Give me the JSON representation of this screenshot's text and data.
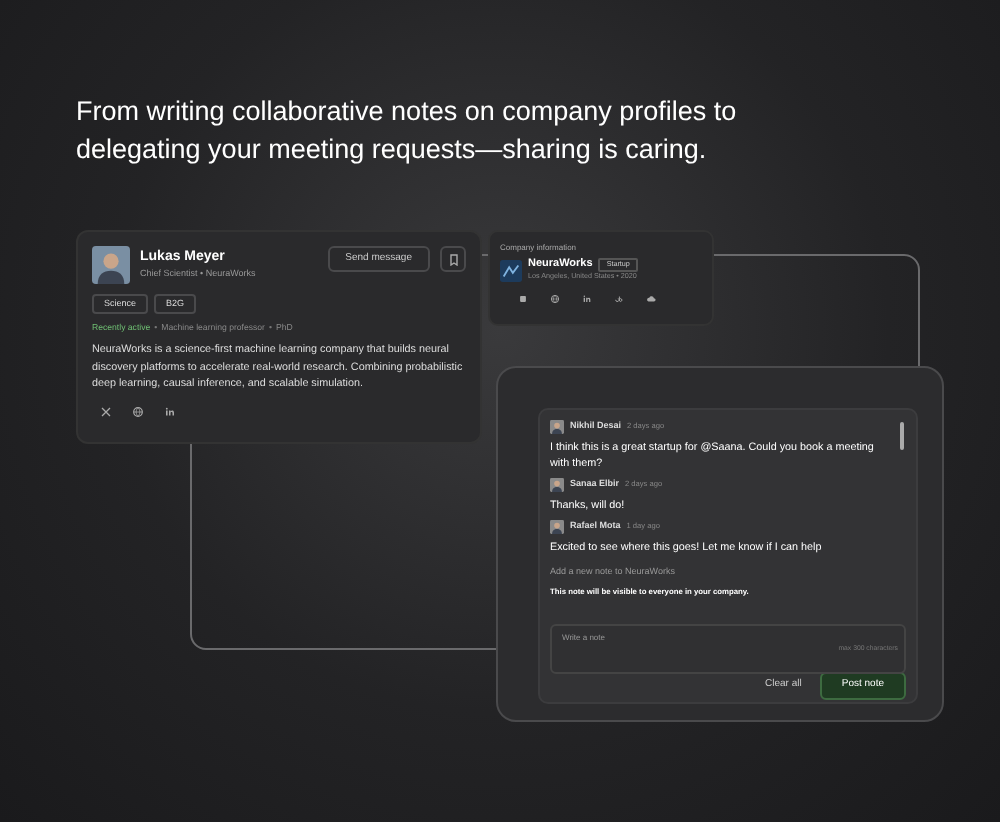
{
  "headline": "From writing collaborative notes on company profiles to delegating your meeting requests—sharing is caring.",
  "profile": {
    "name": "Lukas Meyer",
    "subtitle": "Chief Scientist • NeuraWorks",
    "send_button": "Send message",
    "tags": [
      "Science",
      "B2G"
    ],
    "separator": "•",
    "meta": [
      {
        "text": "Recently active",
        "kind": "status"
      },
      {
        "text": "Machine learning professor",
        "kind": "plain"
      },
      {
        "text": "PhD",
        "kind": "plain"
      }
    ],
    "bio": "NeuraWorks is a science-first machine learning company that builds neural discovery platforms to accelerate real-world research. Combining probabilistic deep learning, causal inference, and scalable simulation.",
    "socials": [
      {
        "kind": "x"
      },
      {
        "kind": "globe"
      },
      {
        "kind": "linkedin"
      }
    ]
  },
  "company": {
    "heading": "Company information",
    "name": "NeuraWorks",
    "badge": "Startup",
    "location": "Los Angeles, United States • 2020",
    "links": [
      {
        "kind": "square"
      },
      {
        "kind": "globe"
      },
      {
        "kind": "linkedin"
      },
      {
        "kind": "crunchbase"
      },
      {
        "kind": "cloud"
      }
    ]
  },
  "notes": {
    "comments": [
      {
        "author": "Nikhil Desai",
        "time": "2 days ago",
        "text": "I think this is a great startup for @Saana. Could you book a meeting with them?"
      },
      {
        "author": "Sanaa Elbir",
        "time": "2 days ago",
        "text": "Thanks, will do!"
      },
      {
        "author": "Rafael Mota",
        "time": "1 day ago",
        "text": "Excited to see where this goes! Let me know if I can help"
      }
    ],
    "add_label": "Add a new note to NeuraWorks",
    "visibility": "This note will be visible to everyone in your company.",
    "placeholder": "Write a note",
    "limit": "max 300 characters",
    "clear_button": "Clear all",
    "post_button": "Post note"
  }
}
